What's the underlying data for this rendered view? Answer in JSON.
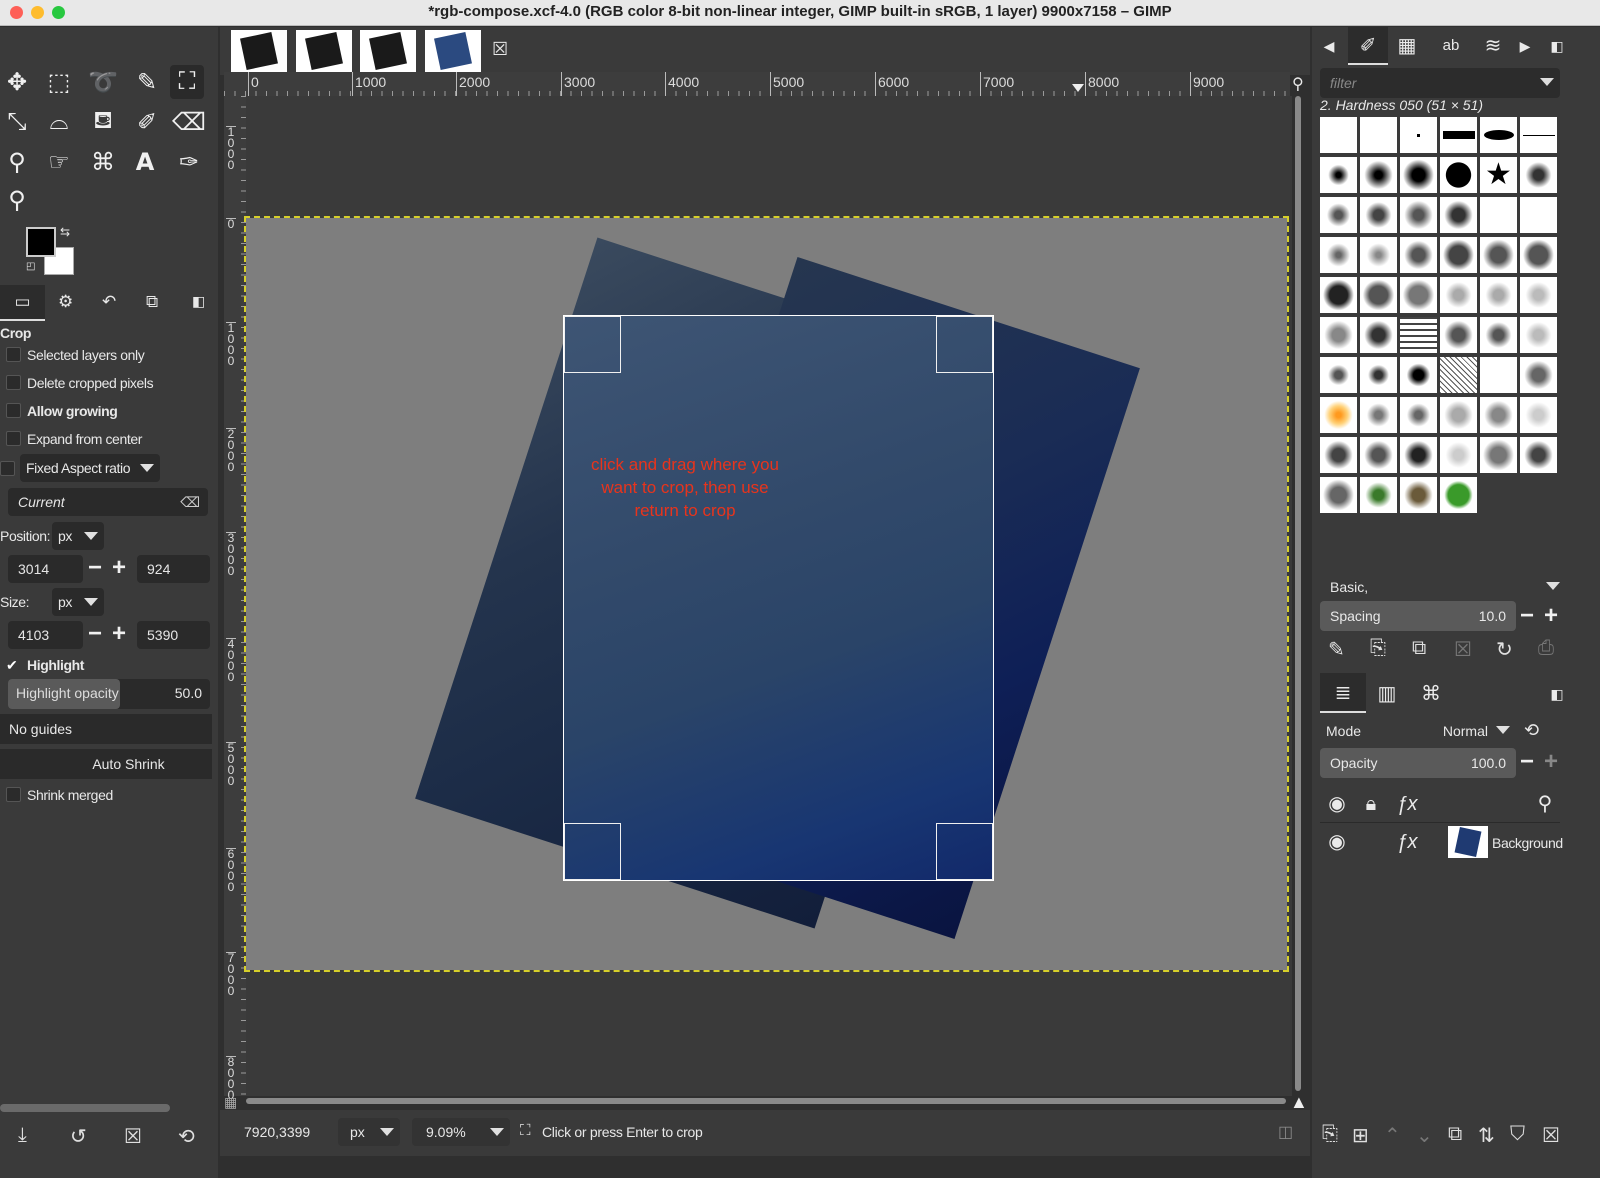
{
  "window": {
    "title": "*rgb-compose.xcf-4.0 (RGB color 8-bit non-linear integer, GIMP built-in sRGB, 1 layer) 9900x7158 – GIMP"
  },
  "tool_options": {
    "title": "Crop",
    "selected_layers_only": "Selected layers only",
    "delete_cropped_pixels": "Delete cropped pixels",
    "allow_growing": "Allow growing",
    "expand_from_center": "Expand from center",
    "fixed_aspect": "Fixed Aspect ratio",
    "aspect_value": "Current",
    "position_label": "Position:",
    "position_unit": "px",
    "position_x": "3014",
    "position_y": "924",
    "size_label": "Size:",
    "size_unit": "px",
    "size_w": "4103",
    "size_h": "5390",
    "highlight": "Highlight",
    "highlight_opacity_label": "Highlight opacity",
    "highlight_opacity_value": "50.0",
    "guides": "No guides",
    "auto_shrink": "Auto Shrink",
    "shrink_merged": "Shrink merged"
  },
  "ruler": {
    "h_labels": [
      "0",
      "1000",
      "2000",
      "3000",
      "4000",
      "5000",
      "6000",
      "7000",
      "8000",
      "9000"
    ],
    "v_labels": [
      "1000",
      "0",
      "1000",
      "2000",
      "3000",
      "4000",
      "5000",
      "6000",
      "7000",
      "8000"
    ]
  },
  "canvas": {
    "annotation": "click and drag where you want to crop, then use return to crop"
  },
  "status": {
    "coords": "7920,3399",
    "unit": "px",
    "zoom": "9.09%",
    "message": "Click or press Enter to crop"
  },
  "brushes": {
    "filter_placeholder": "filter",
    "current": "2. Hardness 050 (51 × 51)",
    "preset": "Basic,",
    "spacing_label": "Spacing",
    "spacing_value": "10.0"
  },
  "layers": {
    "mode_label": "Mode",
    "mode_value": "Normal",
    "opacity_label": "Opacity",
    "opacity_value": "100.0",
    "items": [
      {
        "name": "Background"
      }
    ]
  }
}
